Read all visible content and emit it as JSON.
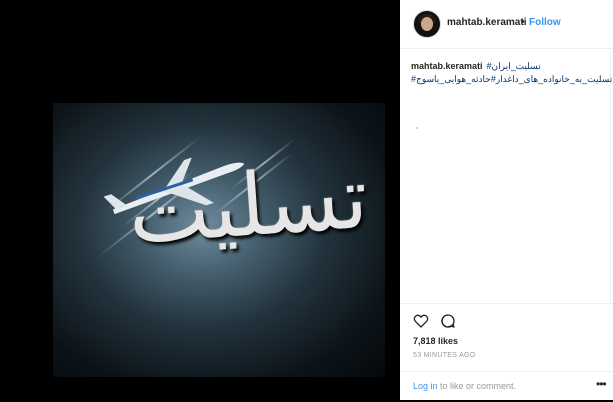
{
  "post": {
    "media_text": "تسلیت"
  },
  "header": {
    "username": "mahtab.keramati",
    "separator": "•",
    "follow_label": "Follow"
  },
  "caption": {
    "username": "mahtab.keramati",
    "line1_tag": "#تسلیت_ایران",
    "line2_tags": "#تسلیت_به_خانواده_های_داغدار#حادثه_هوایی_یاسوج"
  },
  "actions": {
    "likes": "7,818 likes",
    "timestamp": "53 MINUTES AGO"
  },
  "footer": {
    "login_link": "Log in",
    "login_suffix": " to like or comment.",
    "more": "•••"
  },
  "icons": {
    "heart": "heart-icon",
    "comment": "comment-icon"
  },
  "colors": {
    "link": "#3897f0",
    "hashtag": "#003569"
  }
}
